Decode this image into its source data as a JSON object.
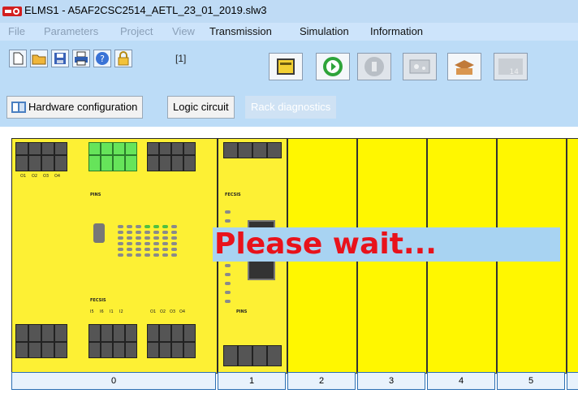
{
  "window": {
    "title": "ELMS1 - A5AF2CSC2514_AETL_23_01_2019.slw3"
  },
  "menu": {
    "items": [
      {
        "label": "File",
        "enabled": false
      },
      {
        "label": "Parameters",
        "enabled": false
      },
      {
        "label": "Project",
        "enabled": false
      },
      {
        "label": "View",
        "enabled": false
      },
      {
        "label": "Transmission",
        "enabled": true
      },
      {
        "label": "Simulation",
        "enabled": true
      },
      {
        "label": "Information",
        "enabled": true
      }
    ]
  },
  "toolbar": {
    "buttons": [
      "new-icon",
      "open-icon",
      "save-icon",
      "print-icon",
      "help-icon",
      "lock-icon"
    ],
    "lock_level": "[1]",
    "big_buttons": [
      "module-config-icon",
      "connect-icon",
      "disconnect-icon",
      "monitor-icon",
      "upload-icon",
      "counter-icon"
    ]
  },
  "tabs": [
    {
      "label": "Hardware configuration",
      "enabled": true
    },
    {
      "label": "Logic circuit",
      "enabled": true
    },
    {
      "label": "Rack diagnostics",
      "enabled": false
    }
  ],
  "rack": {
    "slots": [
      "0",
      "1",
      "2",
      "3",
      "4",
      "5"
    ],
    "main_module": {
      "model": "FECSIS",
      "top_labels": [
        "O1",
        "O2",
        "O3",
        "O4"
      ],
      "brand": "PINS",
      "bottom_labels": [
        "I5",
        "I6",
        "I1",
        "I2",
        "O1",
        "O2",
        "O3",
        "O4"
      ]
    },
    "expansion_module": {
      "model": "FECSIS",
      "brand": "PINS"
    }
  },
  "overlay": {
    "message": "Please wait..."
  },
  "colors": {
    "module_yellow": "#fdf034",
    "wait_text": "#e8121b",
    "toolbar_bg": "#bcdcf7"
  }
}
